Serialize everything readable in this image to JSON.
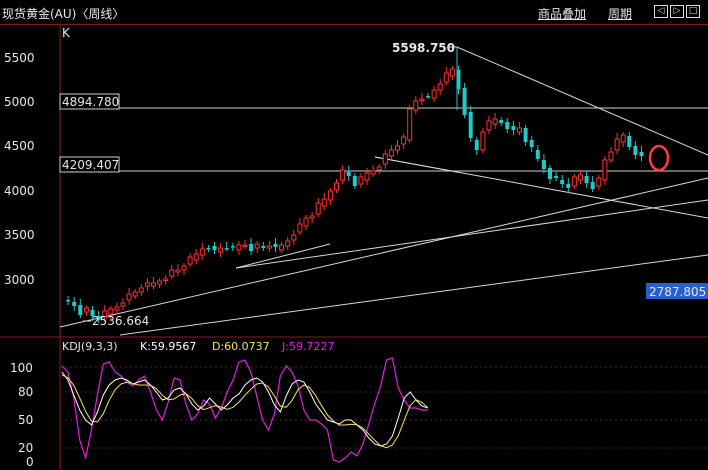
{
  "header": {
    "title": "现货黄金(AU)〈周线〉",
    "overlay_label": "商品叠加",
    "period_label": "周期",
    "nav": {
      "left": "◁",
      "right": "▷",
      "max": "□"
    }
  },
  "main_panel": {
    "label": "K",
    "y_ticks": [
      "5500",
      "5000",
      "4500",
      "4000",
      "3500",
      "3000"
    ],
    "high_label": "5598.750",
    "low_label": "2536.664",
    "level_boxes": [
      "4894.780",
      "4209.407"
    ],
    "current_price_box": "2787.805"
  },
  "kdj_panel": {
    "label": "KDJ(9,3,3)",
    "k_text": "K:59.9567",
    "d_text": "D:60.0737",
    "j_text": "J:59.7227",
    "y_ticks": [
      "100",
      "80",
      "50",
      "20",
      "0"
    ]
  },
  "colors": {
    "up": "#ff3030",
    "down": "#21c9c9",
    "k": "#ffffff",
    "d": "#f2e45a",
    "j": "#e020e0",
    "trendline": "#d8d8d8",
    "highlight_box": "#2a5fd0",
    "circle": "#ff3b3b",
    "separator": "#8a1a1a"
  }
}
